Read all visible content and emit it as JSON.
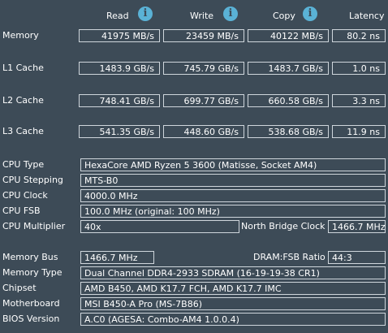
{
  "headers": {
    "read": "Read",
    "write": "Write",
    "copy": "Copy",
    "latency": "Latency",
    "info_glyph": "i"
  },
  "rows": {
    "memory": {
      "label": "Memory",
      "read": "41975 MB/s",
      "write": "23459 MB/s",
      "copy": "40122 MB/s",
      "latency": "80.2 ns"
    },
    "l1": {
      "label": "L1 Cache",
      "read": "1483.9 GB/s",
      "write": "745.79 GB/s",
      "copy": "1483.7 GB/s",
      "latency": "1.0 ns"
    },
    "l2": {
      "label": "L2 Cache",
      "read": "748.41 GB/s",
      "write": "699.77 GB/s",
      "copy": "660.58 GB/s",
      "latency": "3.3 ns"
    },
    "l3": {
      "label": "L3 Cache",
      "read": "541.35 GB/s",
      "write": "448.60 GB/s",
      "copy": "538.68 GB/s",
      "latency": "11.9 ns"
    }
  },
  "info": {
    "cpu_type": {
      "label": "CPU Type",
      "value": "HexaCore AMD Ryzen 5 3600  (Matisse, Socket AM4)"
    },
    "cpu_stepping": {
      "label": "CPU Stepping",
      "value": "MTS-B0"
    },
    "cpu_clock": {
      "label": "CPU Clock",
      "value": "4000.0 MHz"
    },
    "cpu_fsb": {
      "label": "CPU FSB",
      "value": "100.0 MHz  (original: 100 MHz)"
    },
    "cpu_multiplier": {
      "label": "CPU Multiplier",
      "value": "40x"
    },
    "north_bridge_clock": {
      "label": "North Bridge Clock",
      "value": "1466.7 MHz"
    },
    "memory_bus": {
      "label": "Memory Bus",
      "value": "1466.7 MHz"
    },
    "dram_fsb_ratio": {
      "label": "DRAM:FSB Ratio",
      "value": "44:3"
    },
    "memory_type": {
      "label": "Memory Type",
      "value": "Dual Channel DDR4-2933 SDRAM  (16-19-19-38 CR1)"
    },
    "chipset": {
      "label": "Chipset",
      "value": "AMD B450, AMD K17.7 FCH, AMD K17.7 IMC"
    },
    "motherboard": {
      "label": "Motherboard",
      "value": "MSI B450-A Pro (MS-7B86)"
    },
    "bios_version": {
      "label": "BIOS Version",
      "value": "A.C0  (AGESA: Combo-AM4 1.0.0.4)"
    }
  }
}
